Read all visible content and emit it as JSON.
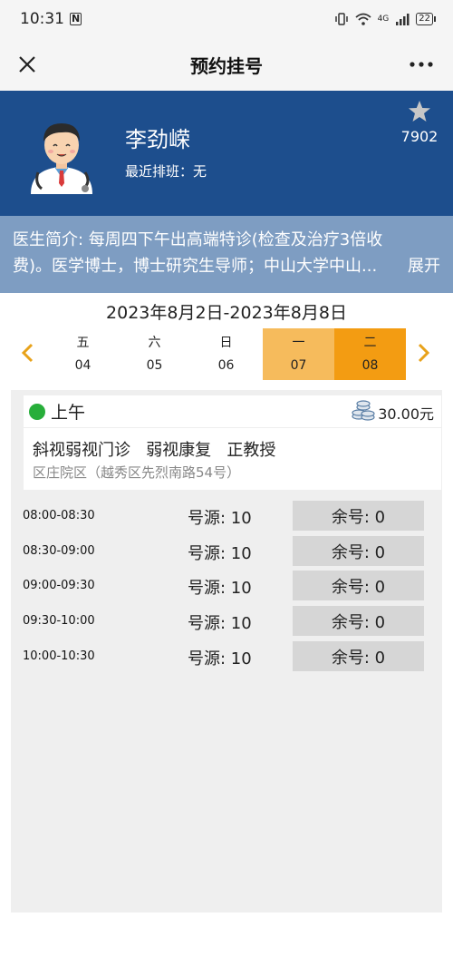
{
  "status_bar": {
    "time": "10:31",
    "n_badge": "N",
    "network": "4G",
    "battery": "22"
  },
  "titlebar": {
    "title": "预约挂号"
  },
  "doctor": {
    "name": "李劲嵘",
    "schedule_label": "最近排班：无",
    "fav_count": "7902",
    "intro_line1": "医生简介: 每周四下午出高端特诊(检查及治疗3倍收",
    "intro_line2": "费)。医学博士，博士研究生导师；中山大学中山...",
    "intro_more": "展开"
  },
  "calendar": {
    "range": "2023年8月2日-2023年8月8日",
    "days": [
      {
        "weekday": "五",
        "date": "04"
      },
      {
        "weekday": "六",
        "date": "05"
      },
      {
        "weekday": "日",
        "date": "06"
      },
      {
        "weekday": "一",
        "date": "07"
      },
      {
        "weekday": "二",
        "date": "08"
      }
    ]
  },
  "session": {
    "period": "上午",
    "price": "30.00元",
    "dept": "斜视弱视门诊   弱视康复   正教授",
    "address": "区庄院区（越秀区先烈南路54号）"
  },
  "slots": [
    {
      "time": "08:00-08:30",
      "source": "号源: 10",
      "remain": "余号: 0"
    },
    {
      "time": "08:30-09:00",
      "source": "号源: 10",
      "remain": "余号: 0"
    },
    {
      "time": "09:00-09:30",
      "source": "号源: 10",
      "remain": "余号: 0"
    },
    {
      "time": "09:30-10:00",
      "source": "号源: 10",
      "remain": "余号: 0"
    },
    {
      "time": "10:00-10:30",
      "source": "号源: 10",
      "remain": "余号: 0"
    }
  ],
  "colors": {
    "header_blue": "#1d4e8d",
    "intro_blue": "#7e9dc2",
    "accent_orange": "#f39c12",
    "light_orange": "#f6bb5c",
    "green_dot": "#27ae3a"
  }
}
